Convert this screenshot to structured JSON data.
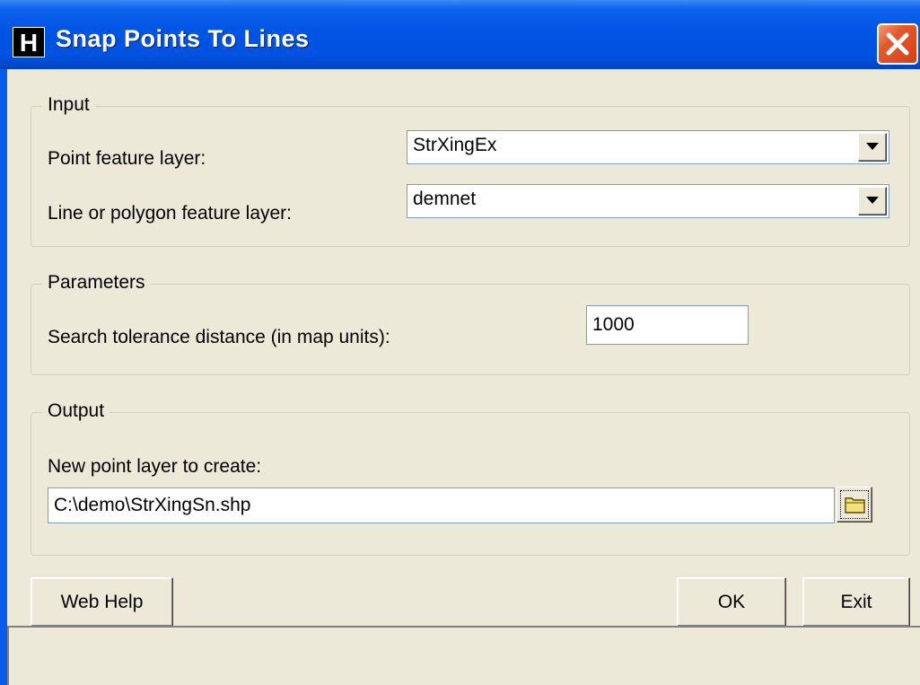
{
  "window": {
    "title": "Snap Points To Lines",
    "icon_letter": "H"
  },
  "input": {
    "group_label": "Input",
    "point_layer_label": "Point feature layer:",
    "point_layer_value": "StrXingEx",
    "line_layer_label": "Line or polygon feature layer:",
    "line_layer_value": "demnet"
  },
  "parameters": {
    "group_label": "Parameters",
    "tolerance_label": "Search tolerance distance (in map units):",
    "tolerance_value": "1000"
  },
  "output": {
    "group_label": "Output",
    "new_layer_label": "New point layer to create:",
    "new_layer_value": "C:\\demo\\StrXingSn.shp"
  },
  "buttons": {
    "web_help": "Web Help",
    "ok": "OK",
    "exit": "Exit"
  },
  "icons": [
    "close-icon",
    "dropdown-arrow-icon",
    "folder-icon"
  ],
  "colors": {
    "titlebar": "#0054e3",
    "face": "#ece9d8",
    "close": "#e3592e"
  }
}
